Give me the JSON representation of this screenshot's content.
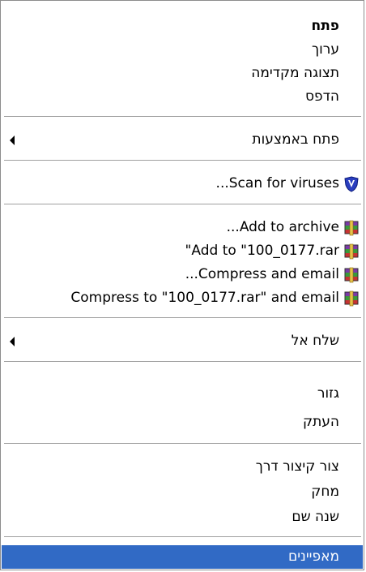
{
  "menu": {
    "open": "פתח",
    "edit": "ערוך",
    "preview": "תצוגה מקדימה",
    "print": "הדפס",
    "open_with": "פתח באמצעות",
    "scan": "Scan for viruses...",
    "add_archive": "Add to archive...",
    "add_rar": "Add to \"100_0177.rar\"",
    "compress_email": "Compress and email...",
    "compress_rar_email": "Compress to \"100_0177.rar\" and email",
    "send_to": "שלח אל",
    "cut": "גזור",
    "copy": "העתק",
    "shortcut": "צור קיצור דרך",
    "delete": "מחק",
    "rename": "שנה שם",
    "properties": "מאפיינים"
  },
  "colors": {
    "selection": "#316ac5",
    "separator": "#a0a0a0"
  }
}
